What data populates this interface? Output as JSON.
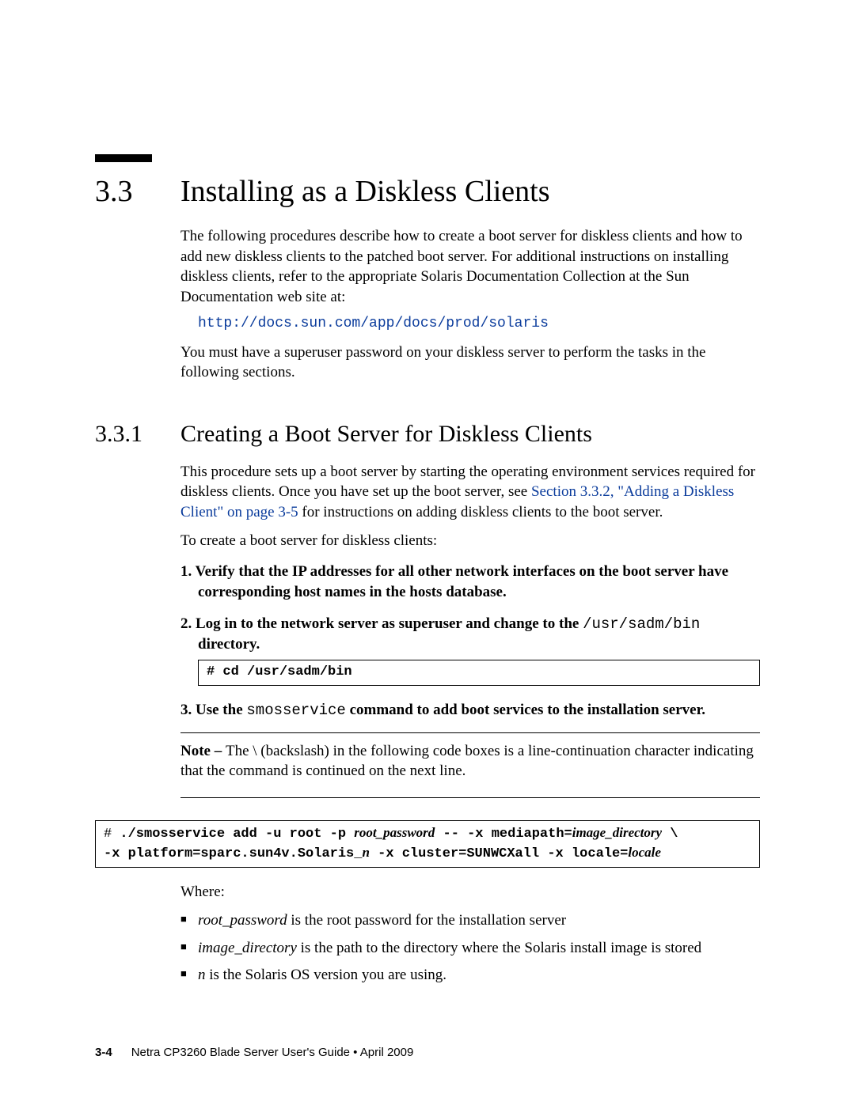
{
  "section": {
    "number": "3.3",
    "title": "Installing as a Diskless Clients",
    "intro1": "The following procedures describe how to create a boot server for diskless clients and how to add new diskless clients to the patched boot server. For additional instructions on installing diskless clients, refer to the appropriate Solaris Documentation Collection at the Sun Documentation web site at:",
    "url": "http://docs.sun.com/app/docs/prod/solaris",
    "intro2": "You must have a superuser password on your diskless server to perform the tasks in the following sections."
  },
  "subsection": {
    "number": "3.3.1",
    "title": "Creating a Boot Server for Diskless Clients",
    "para1_pre": "This procedure sets up a boot server by starting the operating environment services required for diskless clients. Once you have set up the boot server, see ",
    "para1_xref": "Section 3.3.2, \"Adding a Diskless Client\" on page 3-5",
    "para1_post": " for instructions on adding diskless clients to the boot server.",
    "lead": "To create a boot server for diskless clients:",
    "steps": {
      "s1": {
        "num": "1.",
        "text": "Verify that the IP addresses for all other network interfaces on the boot server have corresponding host names in the hosts database."
      },
      "s2": {
        "num": "2.",
        "text_pre": "Log in to the network server as superuser and change to the ",
        "path": "/usr/sadm/bin",
        "text_post": " directory."
      },
      "s2_code_prompt": "# ",
      "s2_code_cmd": "cd /usr/sadm/bin",
      "s3": {
        "num": "3.",
        "text_pre": "Use the ",
        "cmd": "smosservice",
        "text_post": " command to add boot services to the installation server."
      }
    },
    "note": {
      "label": "Note – ",
      "text": "The \\ (backslash) in the following code boxes is a line-continuation character indicating that the command is continued on the next line."
    },
    "bigcode": {
      "l1_prompt": "# ",
      "l1_a": "./smosservice add -u root -p ",
      "l1_var1": "root_password",
      "l1_b": " -- -x mediapath=",
      "l1_var2": "image_directory",
      "l1_c": " \\",
      "l2_a": "-x platform=sparc.sun4v.Solaris_",
      "l2_var1": "n",
      "l2_b": " -x cluster=SUNWCXall -x locale=",
      "l2_var2": "locale"
    },
    "where_label": "Where:",
    "where": {
      "w1_var": "root_password",
      "w1_text": " is the root password for the installation server",
      "w2_var": "image_directory",
      "w2_text": " is the path to the directory where the Solaris install image is stored",
      "w3_var": "n",
      "w3_text": " is the Solaris OS version you are using."
    }
  },
  "footer": {
    "page": "3-4",
    "text": "Netra CP3260 Blade Server User's Guide  •  April 2009"
  }
}
